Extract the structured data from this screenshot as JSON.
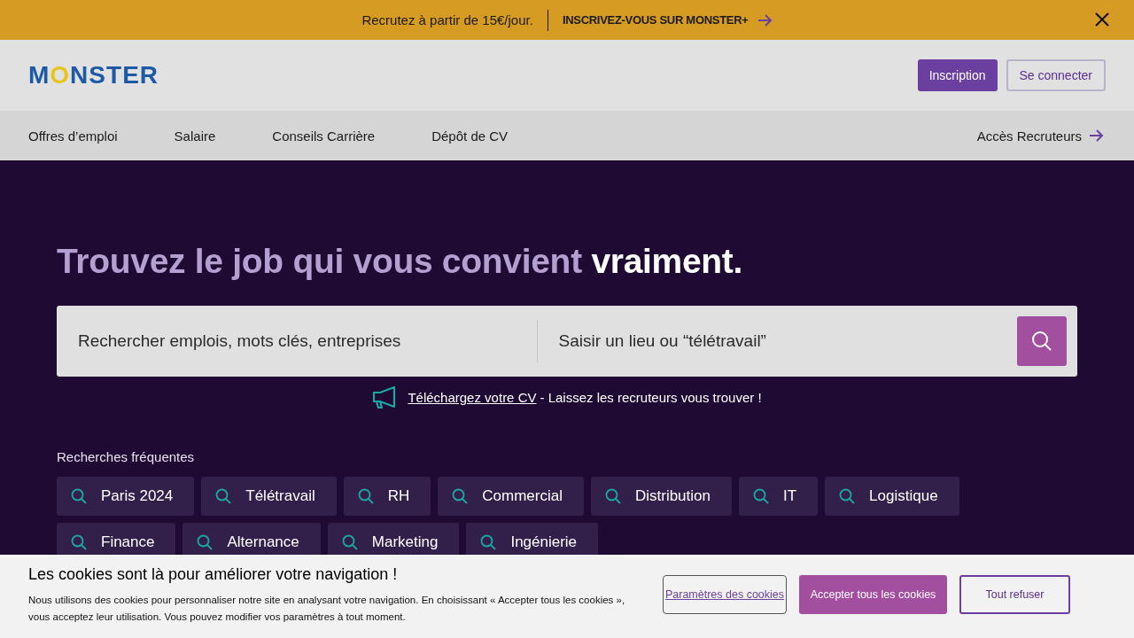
{
  "promo_bar": {
    "text": "Recrutez à partir de 15€/jour.",
    "link": "INSCRIVEZ-VOUS SUR MONSTER+"
  },
  "header": {
    "logo": "MONSTER",
    "buttons": [
      {
        "label": "Inscription",
        "kind": "primary"
      },
      {
        "label": "Se connecter",
        "kind": "outline"
      }
    ]
  },
  "nav": {
    "items": [
      "Offres d’emploi",
      "Salaire",
      "Conseils Carrière",
      "Dépôt de CV"
    ],
    "recruiter_link": "Accès Recruteurs"
  },
  "hero": {
    "headline": "Trouvez le job qui vous convient **vraiment.**",
    "search": {
      "keyword_placeholder": "Rechercher emplois, mots clés, entreprises",
      "location_placeholder": "Saisir un lieu ou “télétravail”"
    },
    "cv_link": "Téléchargez votre CV",
    "cv_text": "- Laissez les recruteurs vous trouver !",
    "frequent_title": "Recherches fréquentes",
    "frequent_searches": [
      "Paris 2024",
      "Télétravail",
      "RH",
      "Commercial",
      "Distribution",
      "IT",
      "Logistique",
      "Finance",
      "Alternance",
      "Marketing",
      "Ingénierie"
    ]
  },
  "cookie_banner": {
    "title": "Les cookies sont là pour améliorer votre navigation !",
    "text": "Nous utilisons des cookies pour personnaliser notre site en analysant votre navigation. En choisissant « Accepter tous les cookies », vous acceptez leur utilisation. Vous pouvez modifier vos paramètres à tout moment.",
    "buttons": [
      {
        "label": "Paramètres des cookies",
        "kind": "link"
      },
      {
        "label": "Accepter tous les cookies",
        "kind": "primary"
      },
      {
        "label": "Tout refuser",
        "kind": "outline"
      }
    ]
  }
}
